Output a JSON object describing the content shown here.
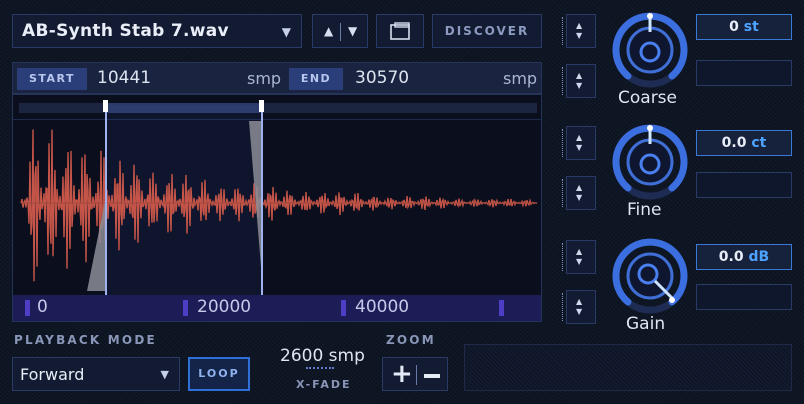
{
  "file": {
    "name": "AB-Synth Stab 7.wav"
  },
  "toolbar": {
    "discover_label": "DISCOVER"
  },
  "range": {
    "start_label": "START",
    "start_value": "10441",
    "start_unit": "smp",
    "end_label": "END",
    "end_value": "30570",
    "end_unit": "smp"
  },
  "ruler": {
    "labels": [
      "0",
      "20000",
      "40000"
    ]
  },
  "playback": {
    "title": "PLAYBACK MODE",
    "mode": "Forward",
    "loop_label": "LOOP"
  },
  "xfade": {
    "value": "2600 smp",
    "label": "X-FADE"
  },
  "zoom": {
    "title": "ZOOM"
  },
  "knobs": [
    {
      "label": "Coarse",
      "value": "0",
      "unit": "st"
    },
    {
      "label": "Fine",
      "value": "0.0",
      "unit": "ct"
    },
    {
      "label": "Gain",
      "value": "0.0",
      "unit": "dB"
    }
  ],
  "colors": {
    "accent": "#3a78d6",
    "wave": "#c45548",
    "knob_ring": "#3b6fe0"
  }
}
